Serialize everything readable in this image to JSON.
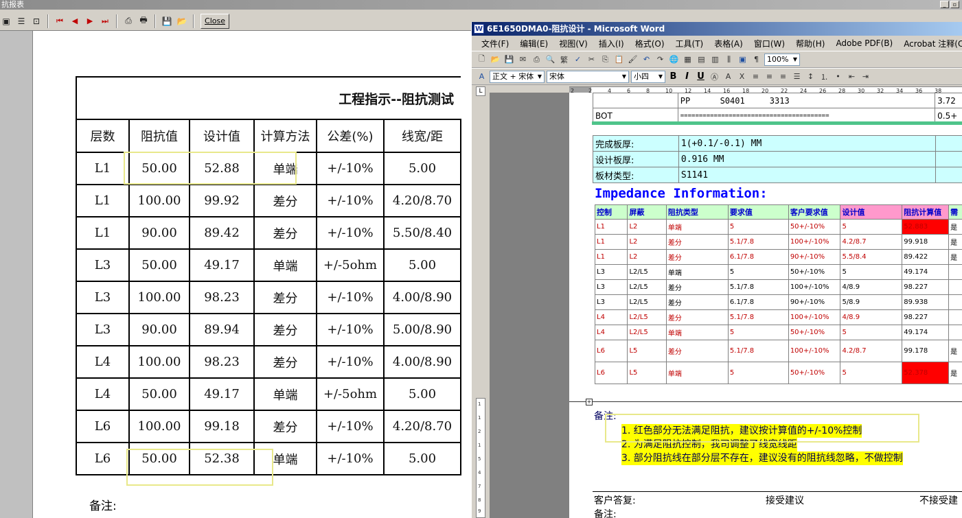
{
  "left_window": {
    "title": "抗报表",
    "close_label": "Close",
    "report_title": "工程指示--阻抗测试",
    "columns": [
      "层数",
      "阻抗值",
      "设计值",
      "计算方法",
      "公差(%)",
      "线宽/距"
    ],
    "rows": [
      [
        "L1",
        "50.00",
        "52.88",
        "单端",
        "+/-10%",
        "5.00"
      ],
      [
        "L1",
        "100.00",
        "99.92",
        "差分",
        "+/-10%",
        "4.20/8.70"
      ],
      [
        "L1",
        "90.00",
        "89.42",
        "差分",
        "+/-10%",
        "5.50/8.40"
      ],
      [
        "L3",
        "50.00",
        "49.17",
        "单端",
        "+/-5ohm",
        "5.00"
      ],
      [
        "L3",
        "100.00",
        "98.23",
        "差分",
        "+/-10%",
        "4.00/8.90"
      ],
      [
        "L3",
        "90.00",
        "89.94",
        "差分",
        "+/-10%",
        "5.00/8.90"
      ],
      [
        "L4",
        "100.00",
        "98.23",
        "差分",
        "+/-10%",
        "4.00/8.90"
      ],
      [
        "L4",
        "50.00",
        "49.17",
        "单端",
        "+/-5ohm",
        "5.00"
      ],
      [
        "L6",
        "100.00",
        "99.18",
        "差分",
        "+/-10%",
        "4.20/8.70"
      ],
      [
        "L6",
        "50.00",
        "52.38",
        "单端",
        "+/-10%",
        "5.00"
      ]
    ],
    "note_label": "备注:"
  },
  "word_window": {
    "title": "6E1650DMA0-阻抗设计 - Microsoft Word",
    "menu": [
      "文件(F)",
      "编辑(E)",
      "视图(V)",
      "插入(I)",
      "格式(O)",
      "工具(T)",
      "表格(A)",
      "窗口(W)",
      "帮助(H)",
      "Adobe PDF(B)",
      "Acrobat 注释(C)"
    ],
    "zoom": "100%",
    "style": "正文 + 宋体",
    "font": "宋体",
    "size": "小四",
    "ruler_ticks": [
      "2",
      "2",
      "4",
      "6",
      "8",
      "10",
      "12",
      "14",
      "16",
      "18",
      "20",
      "22",
      "24",
      "26",
      "28",
      "30",
      "32",
      "34",
      "36",
      "38"
    ],
    "top_rows": [
      [
        "",
        "PP      S0401     3313",
        "3.72"
      ],
      [
        "BOT",
        "========================================",
        "0.5+"
      ]
    ],
    "spec_rows": [
      [
        "完成板厚:",
        "1(+0.1/-0.1) MM",
        ""
      ],
      [
        "设计板厚:",
        "0.916 MM",
        ""
      ],
      [
        "板材类型:",
        "S1141",
        ""
      ]
    ],
    "impedance_title": "Impedance Information:",
    "imp_headers": [
      "控制",
      "屏蔽",
      "阻抗类型",
      "要求值",
      "客户要求值",
      "设计值",
      "阻抗计算值",
      "需"
    ],
    "imp_rows": [
      [
        "L1",
        "L2",
        "单端",
        "5",
        "50+/-10%",
        "5",
        "52.883",
        "是"
      ],
      [
        "L1",
        "L2",
        "差分",
        "5.1/7.8",
        "100+/-10%",
        "4.2/8.7",
        "99.918",
        "是"
      ],
      [
        "L1",
        "L2",
        "差分",
        "6.1/7.8",
        "90+/-10%",
        "5.5/8.4",
        "89.422",
        "是"
      ],
      [
        "L3",
        "L2/L5",
        "单端",
        "5",
        "50+/-10%",
        "5",
        "49.174",
        ""
      ],
      [
        "L3",
        "L2/L5",
        "差分",
        "5.1/7.8",
        "100+/-10%",
        "4/8.9",
        "98.227",
        ""
      ],
      [
        "L3",
        "L2/L5",
        "差分",
        "6.1/7.8",
        "90+/-10%",
        "5/8.9",
        "89.938",
        ""
      ],
      [
        "L4",
        "L2/L5",
        "差分",
        "5.1/7.8",
        "100+/-10%",
        "4/8.9",
        "98.227",
        ""
      ],
      [
        "L4",
        "L2/L5",
        "单端",
        "5",
        "50+/-10%",
        "5",
        "49.174",
        ""
      ],
      [
        "L6",
        "L5",
        "差分",
        "5.1/7.8",
        "100+/-10%",
        "4.2/8.7",
        "99.178",
        "是"
      ],
      [
        "L6",
        "L5",
        "单端",
        "5",
        "50+/-10%",
        "5",
        "52.378",
        "是"
      ]
    ],
    "notes_label": "备注:",
    "notes": [
      "1. 红色部分无法满足阻抗，建议按计算值的+/-10%控制",
      "2. 为满足阻抗控制，我司调整了线宽线距",
      "3. 部分阻抗线在部分层不存在，建议没有的阻抗线忽略，不做控制"
    ],
    "reply_label": "客户答复:",
    "accept": "接受建议",
    "reject": "不接受建",
    "remark_label": "备注:"
  },
  "colors": {
    "word_title_start": "#0a246a",
    "highlight_box": "#e8e88a",
    "spec_bg": "#ccffff",
    "impedance_title": "#0000ff",
    "red_row": "#c00000",
    "red_cell": "#ff0000",
    "yellow_highlight": "#ffff00"
  }
}
